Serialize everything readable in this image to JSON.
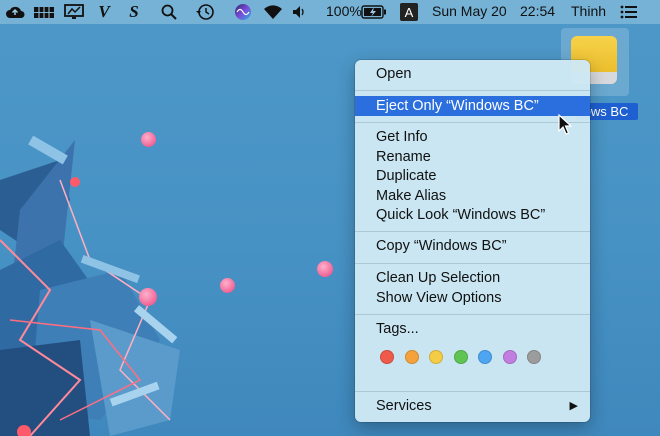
{
  "menubar": {
    "icons": [
      "creative-cloud-icon",
      "storage-icon",
      "monitor-icon",
      "vietnamese-v-icon",
      "skype-s-icon",
      "search-icon",
      "time-machine-icon",
      "siri-icon",
      "wifi-icon",
      "volume-icon",
      "battery-icon",
      "input-source-icon",
      "list-icon"
    ],
    "battery_percent": "100%",
    "input_source": "A",
    "date": "Sun May 20",
    "time": "22:54",
    "user": "Thinh"
  },
  "desktop": {
    "drive_label": "Windows BC"
  },
  "context_menu": {
    "items": {
      "open": "Open",
      "eject": "Eject Only “Windows BC”",
      "get_info": "Get Info",
      "rename": "Rename",
      "duplicate": "Duplicate",
      "make_alias": "Make Alias",
      "quick_look": "Quick Look “Windows BC”",
      "copy": "Copy “Windows BC”",
      "clean_up": "Clean Up Selection",
      "view_options": "Show View Options",
      "tags": "Tags...",
      "services": "Services"
    },
    "highlighted_item": "eject",
    "tag_colors": [
      "#ef5a4a",
      "#f4a23b",
      "#f4cc45",
      "#5fc451",
      "#4ea5f2",
      "#c17ee0",
      "#9c9c9c"
    ]
  },
  "colors": {
    "desktop": "#4792c4",
    "highlight": "#2b6fdf",
    "menu_bg": "#cde8f4"
  }
}
